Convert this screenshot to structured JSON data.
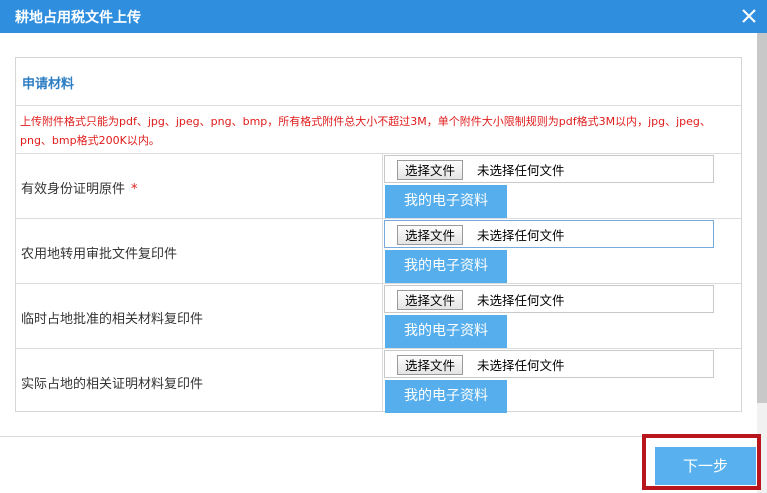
{
  "dialog": {
    "title": "耕地占用税文件上传",
    "close_icon": "close-icon"
  },
  "section": {
    "title": "申请材料",
    "notice": "上传附件格式只能为pdf、jpg、jpeg、png、bmp，所有格式附件总大小不超过3M，单个附件大小限制规则为pdf格式3M以内，jpg、jpeg、png、bmp格式200K以内。"
  },
  "rows": [
    {
      "label": "有效身份证明原件",
      "required": "*",
      "choose_label": "选择文件",
      "status": "未选择任何文件",
      "ebutton": "我的电子资料"
    },
    {
      "label": "农用地转用审批文件复印件",
      "choose_label": "选择文件",
      "status": "未选择任何文件",
      "ebutton": "我的电子资料"
    },
    {
      "label": "临时占地批准的相关材料复印件",
      "choose_label": "选择文件",
      "status": "未选择任何文件",
      "ebutton": "我的电子资料"
    },
    {
      "label": "实际占地的相关证明材料复印件",
      "choose_label": "选择文件",
      "status": "未选择任何文件",
      "ebutton": "我的电子资料"
    }
  ],
  "footer": {
    "next_label": "下一步"
  },
  "colors": {
    "titlebar": "#2f8fde",
    "section_title": "#2d7ec3",
    "notice": "#e01b1b",
    "button": "#56aeec",
    "highlight": "#b8161c"
  }
}
